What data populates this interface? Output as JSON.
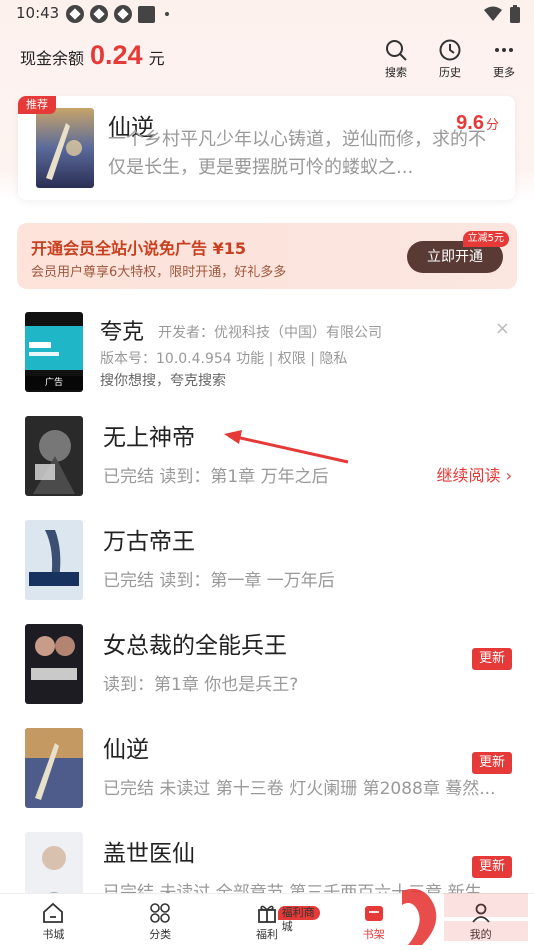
{
  "status": {
    "time": "10:43"
  },
  "header": {
    "balance_label": "现金余额",
    "balance_amount": "0.24",
    "balance_unit": "元",
    "tools": [
      {
        "label": "搜索",
        "icon": "search-icon"
      },
      {
        "label": "历史",
        "icon": "clock-icon"
      },
      {
        "label": "更多",
        "icon": "more-icon"
      }
    ]
  },
  "recommend": {
    "tag": "推荐",
    "title": "仙逆",
    "score": "9.6",
    "score_unit": "分",
    "desc": "一个乡村平凡少年以心铸道，逆仙而修，求的不仅是长生，更是要摆脱可怜的蝼蚁之..."
  },
  "vip": {
    "title": "开通会员全站小说免广告 ¥15",
    "subtitle": "会员用户尊享6大特权，限时开通，好礼多多",
    "button": "立即开通",
    "badge": "立减5元"
  },
  "ad": {
    "name": "夸克",
    "developer": "开发者：优视科技（中国）有限公司",
    "version": "版本号：10.0.4.954   功能 | 权限 | 隐私",
    "slogan": "搜你想搜，夸克搜索",
    "label": "广告",
    "close": "×"
  },
  "books": [
    {
      "name": "无上神帝",
      "meta": "已完结 读到：第1章 万年之后",
      "action": "继续阅读 ›",
      "update": ""
    },
    {
      "name": "万古帝王",
      "meta": "已完结 读到：第一章 一万年后",
      "action": "",
      "update": ""
    },
    {
      "name": "女总裁的全能兵王",
      "meta": "读到：第1章 你也是兵王?",
      "action": "",
      "update": "更新"
    },
    {
      "name": "仙逆",
      "meta": "已完结 未读过 第十三卷 灯火阑珊 第2088章 蓦然...",
      "action": "",
      "update": "更新"
    },
    {
      "name": "盖世医仙",
      "meta": "已完结 未读过 全部章节 第三千两百六十三章 新生",
      "action": "",
      "update": "更新"
    }
  ],
  "nav": {
    "items": [
      {
        "label": "书城",
        "icon": "home-icon"
      },
      {
        "label": "分类",
        "icon": "grid-icon"
      },
      {
        "label": "福利",
        "icon": "gift-icon"
      },
      {
        "label": "书架",
        "icon": "bookshelf-icon"
      },
      {
        "label": "我的",
        "icon": "user-icon"
      }
    ],
    "shop_badge": "福利商城"
  },
  "colors": {
    "accent": "#e53a37",
    "vip_button": "#5a3a34"
  }
}
